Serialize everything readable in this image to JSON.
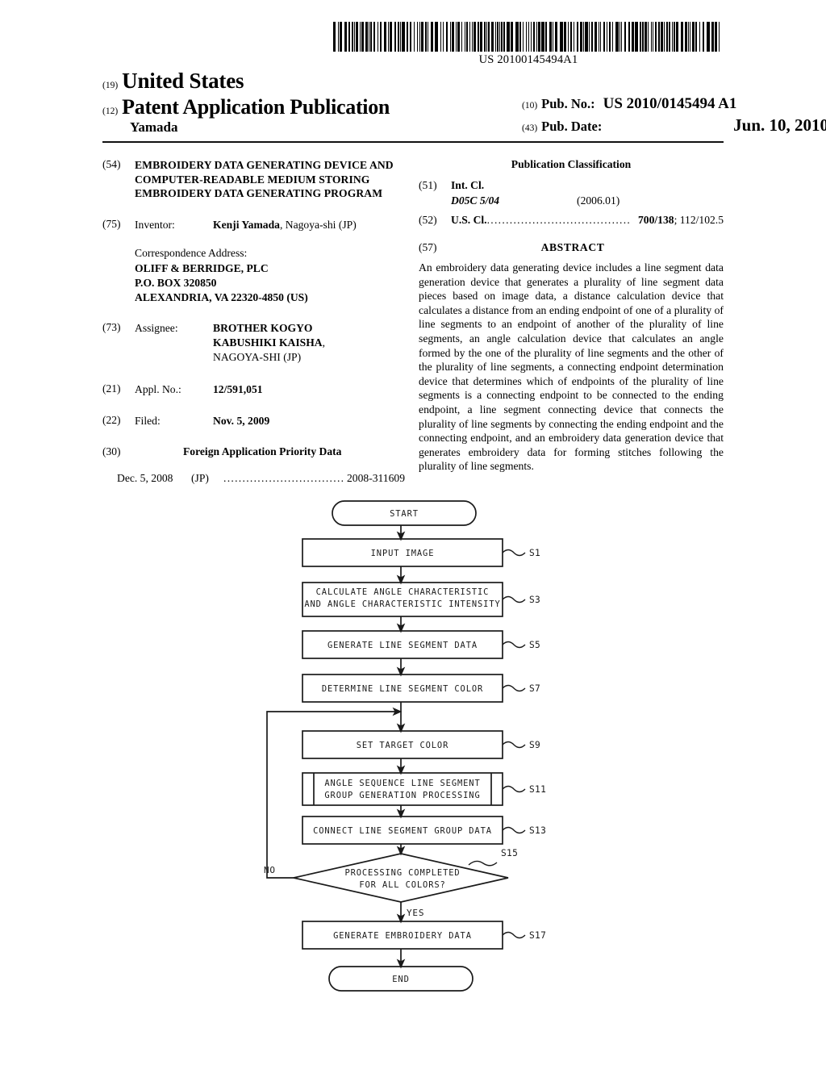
{
  "barcode": {
    "number": "US 20100145494A1"
  },
  "masthead": {
    "code19": "(19)",
    "country": "United States",
    "code12": "(12)",
    "doc_type": "Patent Application Publication",
    "author": "Yamada",
    "code10": "(10)",
    "pub_no_label": "Pub. No.:",
    "pub_no_value": "US 2010/0145494 A1",
    "code43": "(43)",
    "pub_date_label": "Pub. Date:",
    "pub_date_value": "Jun. 10, 2010"
  },
  "left": {
    "title_code": "(54)",
    "title": "EMBROIDERY DATA GENERATING DEVICE AND COMPUTER-READABLE MEDIUM STORING EMBROIDERY DATA GENERATING PROGRAM",
    "inventor_code": "(75)",
    "inventor_label": "Inventor:",
    "inventor_name": "Kenji Yamada",
    "inventor_rest": ", Nagoya-shi (JP)",
    "correspondence_label": "Correspondence Address:",
    "correspondence_line1": "OLIFF & BERRIDGE, PLC",
    "correspondence_line2": "P.O. BOX 320850",
    "correspondence_line3": "ALEXANDRIA, VA 22320-4850 (US)",
    "assignee_code": "(73)",
    "assignee_label": "Assignee:",
    "assignee_line1": "BROTHER KOGYO",
    "assignee_line2": "KABUSHIKI KAISHA",
    "assignee_line2_tail": ",",
    "assignee_line3": "NAGOYA-SHI (JP)",
    "appl_code": "(21)",
    "appl_label": "Appl. No.:",
    "appl_value": "12/591,051",
    "filed_code": "(22)",
    "filed_label": "Filed:",
    "filed_value": "Nov. 5, 2009",
    "fpd_code": "(30)",
    "fpd_heading": "Foreign Application Priority Data",
    "fpd_date": "Dec. 5, 2008",
    "fpd_country": "(JP)",
    "fpd_dots": ".................................",
    "fpd_number": "2008-311609"
  },
  "right": {
    "pub_class_heading": "Publication Classification",
    "int_cl_code": "(51)",
    "int_cl_label": "Int. Cl.",
    "int_cl_value": "D05C 5/04",
    "int_cl_version": "(2006.01)",
    "us_cl_code": "(52)",
    "us_cl_label": "U.S. Cl.",
    "us_cl_dots": "......................................",
    "us_cl_primary": "700/138",
    "us_cl_secondary": "; 112/102.5",
    "abstract_code": "(57)",
    "abstract_heading": "ABSTRACT",
    "abstract_text": "An embroidery data generating device includes a line segment data generation device that generates a plurality of line segment data pieces based on image data, a distance calculation device that calculates a distance from an ending endpoint of one of a plurality of line segments to an endpoint of another of the plurality of line segments, an angle calculation device that calculates an angle formed by the one of the plurality of line segments and the other of the plurality of line segments, a connecting endpoint determination device that determines which of endpoints of the plurality of line segments is a connecting endpoint to be connected to the ending endpoint, a line segment connecting device that connects the plurality of line segments by connecting the ending endpoint and the connecting endpoint, and an embroidery data generation device that generates embroidery data for forming stitches following the plurality of line segments."
  },
  "flowchart": {
    "start": "START",
    "end": "END",
    "yes_label": "YES",
    "no_label": "NO",
    "nodes": [
      {
        "id": "S1",
        "step": "S1",
        "text": "INPUT IMAGE",
        "shape": "process"
      },
      {
        "id": "S3",
        "step": "S3",
        "line1": "CALCULATE ANGLE CHARACTERISTIC",
        "line2": "AND ANGLE CHARACTERISTIC INTENSITY",
        "shape": "process"
      },
      {
        "id": "S5",
        "step": "S5",
        "text": "GENERATE LINE SEGMENT DATA",
        "shape": "process"
      },
      {
        "id": "S7",
        "step": "S7",
        "text": "DETERMINE LINE SEGMENT COLOR",
        "shape": "process"
      },
      {
        "id": "S9",
        "step": "S9",
        "text": "SET TARGET COLOR",
        "shape": "process"
      },
      {
        "id": "S11",
        "step": "S11",
        "line1": "ANGLE SEQUENCE LINE SEGMENT",
        "line2": "GROUP GENERATION PROCESSING",
        "shape": "predefined-process"
      },
      {
        "id": "S13",
        "step": "S13",
        "text": "CONNECT LINE SEGMENT GROUP DATA",
        "shape": "process"
      },
      {
        "id": "S15",
        "step": "S15",
        "line1": "PROCESSING COMPLETED",
        "line2": "FOR ALL COLORS?",
        "shape": "decision"
      },
      {
        "id": "S17",
        "step": "S17",
        "text": "GENERATE EMBROIDERY DATA",
        "shape": "process"
      }
    ]
  }
}
